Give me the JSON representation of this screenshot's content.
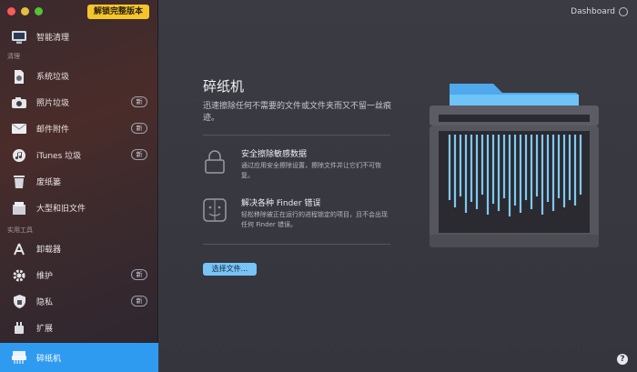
{
  "window": {
    "unlock_label": "解锁完整版本",
    "dashboard_label": "Dashboard"
  },
  "sidebar": {
    "top_item": {
      "label": "智能清理",
      "icon": "monitor-icon"
    },
    "section_clean": "清理",
    "clean_items": [
      {
        "label": "系统垃圾",
        "icon": "system-junk-icon",
        "badge": ""
      },
      {
        "label": "照片垃圾",
        "icon": "camera-icon",
        "badge": "新"
      },
      {
        "label": "邮件附件",
        "icon": "mail-icon",
        "badge": "新"
      },
      {
        "label": "iTunes 垃圾",
        "icon": "music-icon",
        "badge": "新"
      },
      {
        "label": "废纸篓",
        "icon": "trash-icon",
        "badge": ""
      },
      {
        "label": "大型和旧文件",
        "icon": "files-icon",
        "badge": ""
      }
    ],
    "section_tools": "实用工具",
    "tool_items": [
      {
        "label": "卸载器",
        "icon": "app-store-icon",
        "badge": ""
      },
      {
        "label": "维护",
        "icon": "gear-icon",
        "badge": "新"
      },
      {
        "label": "隐私",
        "icon": "shield-icon",
        "badge": "新"
      },
      {
        "label": "扩展",
        "icon": "plug-icon",
        "badge": ""
      },
      {
        "label": "碎纸机",
        "icon": "shredder-icon",
        "badge": "",
        "active": true
      }
    ]
  },
  "main": {
    "title": "碎纸机",
    "subtitle": "迅速擦除任何不需要的文件或文件夹而又不留一丝痕迹。",
    "features": [
      {
        "title": "安全擦除敏感数据",
        "desc": "通过应用安全擦除设置，擦除文件并让它们不可恢复。",
        "icon": "lock-icon"
      },
      {
        "title": "解决各种 Finder 错误",
        "desc": "轻松移除被正在运行的进程锁定的项目，且不会出现任何 Finder 错误。",
        "icon": "finder-icon"
      }
    ],
    "choose_button": "选择文件...",
    "help_label": "?"
  },
  "colors": {
    "accent": "#2f9bf0",
    "unlock": "#f6c52b",
    "button": "#78c4f6"
  }
}
